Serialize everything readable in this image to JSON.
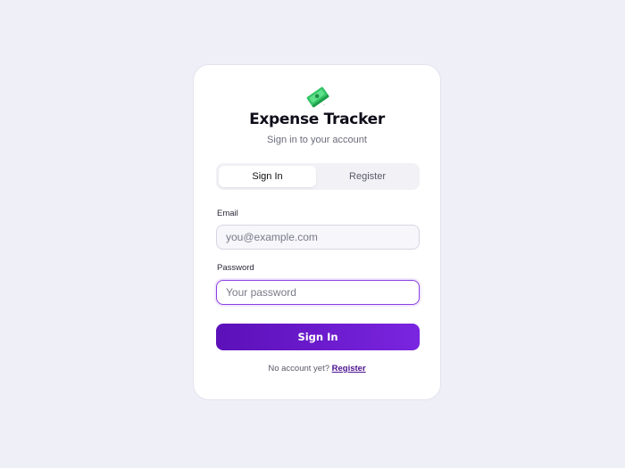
{
  "app": {
    "title": "Expense Tracker",
    "subtitle": "Sign in to your account",
    "logo_icon": "money-icon"
  },
  "tabs": [
    {
      "label": "Sign In",
      "active": true
    },
    {
      "label": "Register",
      "active": false
    }
  ],
  "form": {
    "email_label": "Email",
    "email_value": "",
    "email_placeholder": "you@example.com",
    "password_label": "Password",
    "password_value": "",
    "password_placeholder": "Your password",
    "submit_label": "Sign In"
  },
  "footer": {
    "prompt": "No account yet?",
    "link": "Register"
  },
  "colors": {
    "accent": "#7a25e0",
    "accent_dark": "#5b10b8",
    "background": "#efeff7"
  }
}
